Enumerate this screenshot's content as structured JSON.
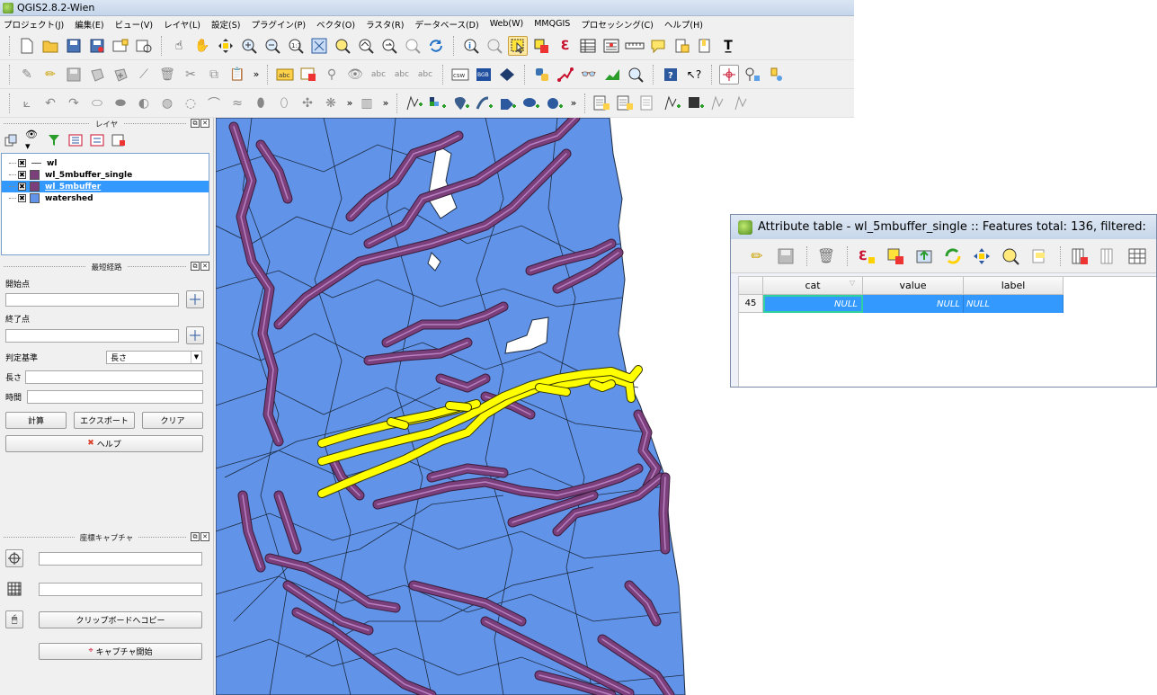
{
  "window": {
    "title": "QGIS2.8.2-Wien"
  },
  "menu": [
    "プロジェクト(J)",
    "編集(E)",
    "ビュー(V)",
    "レイヤ(L)",
    "設定(S)",
    "プラグイン(P)",
    "ベクタ(O)",
    "ラスタ(R)",
    "データベース(D)",
    "Web(W)",
    "MMQGIS",
    "プロセッシング(C)",
    "ヘルプ(H)"
  ],
  "toolbar": {
    "overflow": "»"
  },
  "layers_panel": {
    "title": "レイヤ",
    "layers": [
      {
        "name": "wl",
        "checked": "✖",
        "swatch": "line",
        "color": "#555555"
      },
      {
        "name": "wl_5mbuffer_single",
        "checked": "✖",
        "swatch": "fill",
        "color": "#7b3f7c"
      },
      {
        "name": "wl_5mbuffer",
        "checked": "✖",
        "swatch": "fill",
        "color": "#7b3f7c",
        "selected": true
      },
      {
        "name": "watershed",
        "checked": "✖",
        "swatch": "fill",
        "color": "#6193e8"
      }
    ]
  },
  "shortest_path_panel": {
    "title": "最短経路",
    "start_label": "開始点",
    "end_label": "終了点",
    "criterion_label": "判定基準",
    "criterion_value": "長さ",
    "length_label": "長さ",
    "time_label": "時間",
    "calc_button": "計算",
    "export_button": "エクスポート",
    "clear_button": "クリア",
    "help_button": "ヘルプ"
  },
  "coord_capture_panel": {
    "title": "座標キャプチャ",
    "copy_button": "クリップボードへコピー",
    "start_button": "キャプチャ開始"
  },
  "map": {
    "colors": {
      "watershed": "#6193e8",
      "buffer": "#7b3f7c",
      "buffer_fill": "#b880c0",
      "selected": "#ffff00",
      "outline": "#1d2b40"
    }
  },
  "attribute_table": {
    "title": "Attribute table - wl_5mbuffer_single :: Features total: 136, filtered:",
    "columns": [
      "cat",
      "value",
      "label"
    ],
    "rows": [
      {
        "row_header": "45",
        "cat": "NULL",
        "value": "NULL",
        "label": "NULL"
      }
    ]
  }
}
